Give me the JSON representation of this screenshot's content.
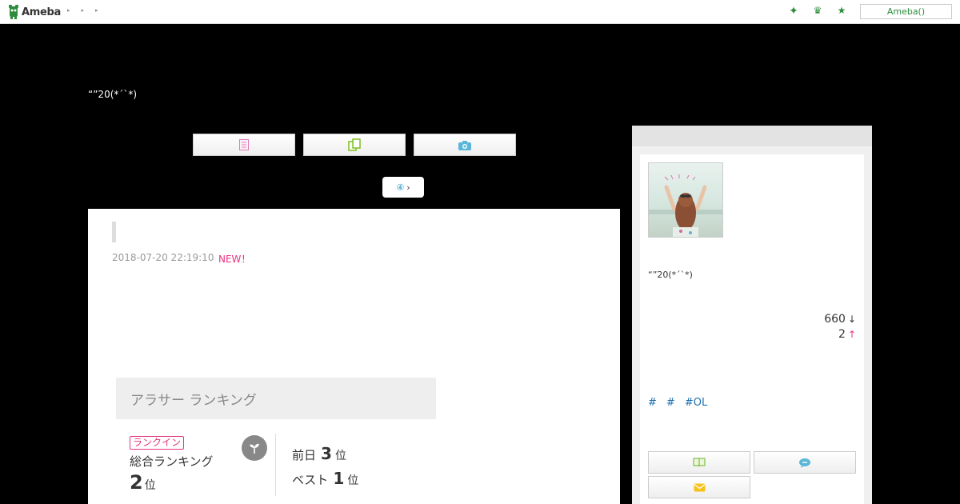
{
  "header": {
    "logo_text": "Ameba",
    "crumbs": [
      "▸",
      "▸",
      "▸"
    ],
    "icons": [
      "sparkle-icon",
      "crown-icon",
      "star-icon"
    ],
    "icon_glyphs": [
      "✦",
      "♛",
      "★"
    ],
    "ameba_button": "Ameba()"
  },
  "blog": {
    "title": "“”20(*´`*)"
  },
  "nav": {
    "buttons": [
      "entry-list-icon",
      "theme-list-icon",
      "photo-icon"
    ],
    "reader_label": "④"
  },
  "entry": {
    "date": "2018-07-20 22:19:10",
    "new_label": "NEW！"
  },
  "ranking": {
    "header": "アラサー ランキング",
    "badge": "ランクイン",
    "label": "総合ランキング",
    "rank": "2",
    "rank_unit": "位",
    "prev_label": "前日",
    "prev_value": "3",
    "prev_unit": "位",
    "best_label": "ベスト",
    "best_value": "1",
    "best_unit": "位"
  },
  "sidebar": {
    "name": "“”20(*´`*)",
    "stat1_value": "660",
    "stat1_arrow": "↓",
    "stat2_value": "2",
    "stat2_arrow": "↑",
    "tags": [
      "#",
      "#",
      "#OL"
    ],
    "buttons": [
      "book-icon",
      "chat-icon",
      "mail-icon"
    ]
  },
  "colors": {
    "ameba_green": "#2d8c3c",
    "new_pink": "#e4337f",
    "tag_blue": "#1a6fb0"
  }
}
